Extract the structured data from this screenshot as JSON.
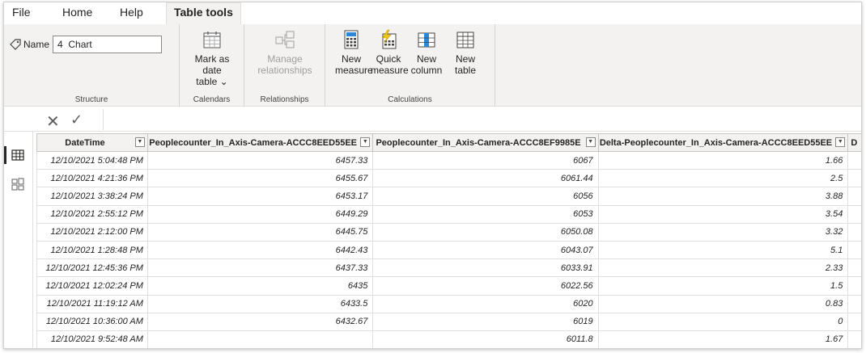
{
  "tabs": [
    {
      "label": "File",
      "active": false
    },
    {
      "label": "Home",
      "active": false
    },
    {
      "label": "Help",
      "active": false
    },
    {
      "label": "Table tools",
      "active": true
    }
  ],
  "ribbon": {
    "name_label": "Name",
    "name_value": "4  Chart",
    "groups": {
      "structure": "Structure",
      "calendars": "Calendars",
      "relationships": "Relationships",
      "calculations": "Calculations"
    },
    "buttons": {
      "mark_date_1": "Mark as date",
      "mark_date_2": "table ⌄",
      "manage_1": "Manage",
      "manage_2": "relationships",
      "new_measure_1": "New",
      "new_measure_2": "measure",
      "quick_measure_1": "Quick",
      "quick_measure_2": "measure",
      "new_column_1": "New",
      "new_column_2": "column",
      "new_table_1": "New",
      "new_table_2": "table"
    }
  },
  "table": {
    "columns": [
      "DateTime",
      "Peoplecounter_In_Axis-Camera-ACCC8EED55EE",
      "Peoplecounter_In_Axis-Camera-ACCC8EF9985E",
      "Delta-Peoplecounter_In_Axis-Camera-ACCC8EED55EE",
      "D"
    ],
    "rows": [
      [
        "12/10/2021 5:04:48 PM",
        "6457.33",
        "6067",
        "1.66"
      ],
      [
        "12/10/2021 4:21:36 PM",
        "6455.67",
        "6061.44",
        "2.5"
      ],
      [
        "12/10/2021 3:38:24 PM",
        "6453.17",
        "6056",
        "3.88"
      ],
      [
        "12/10/2021 2:55:12 PM",
        "6449.29",
        "6053",
        "3.54"
      ],
      [
        "12/10/2021 2:12:00 PM",
        "6445.75",
        "6050.08",
        "3.32"
      ],
      [
        "12/10/2021 1:28:48 PM",
        "6442.43",
        "6043.07",
        "5.1"
      ],
      [
        "12/10/2021 12:45:36 PM",
        "6437.33",
        "6033.91",
        "2.33"
      ],
      [
        "12/10/2021 12:02:24 PM",
        "6435",
        "6022.56",
        "1.5"
      ],
      [
        "12/10/2021 11:19:12 AM",
        "6433.5",
        "6020",
        "0.83"
      ],
      [
        "12/10/2021 10:36:00 AM",
        "6432.67",
        "6019",
        "0"
      ],
      [
        "12/10/2021 9:52:48 AM",
        "",
        "6011.8",
        "1.67"
      ]
    ]
  },
  "icons": {
    "name_tag": "tag-icon",
    "rail": [
      "report-view-icon",
      "data-view-icon",
      "model-view-icon"
    ]
  }
}
